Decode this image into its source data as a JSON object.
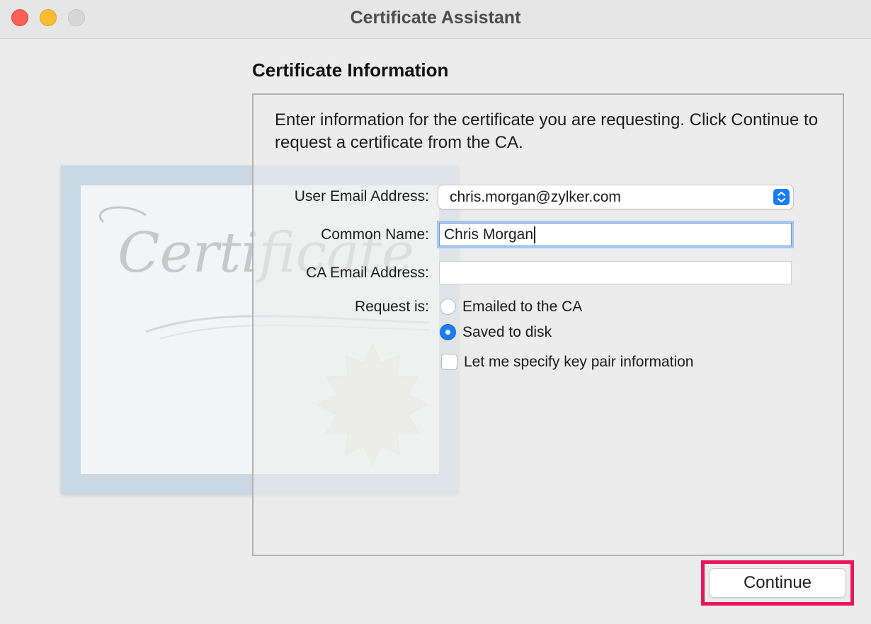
{
  "window": {
    "title": "Certificate Assistant"
  },
  "section": {
    "heading": "Certificate Information",
    "intro": "Enter information for the certificate you are requesting. Click Continue to request a certificate from the CA."
  },
  "form": {
    "user_email_label": "User Email Address:",
    "user_email_value": "chris.morgan@zylker.com",
    "common_name_label": "Common Name:",
    "common_name_value": "Chris Morgan",
    "ca_email_label": "CA Email Address:",
    "ca_email_value": "",
    "request_label": "Request is:",
    "request_options": [
      {
        "label": "Emailed to the CA",
        "selected": false
      },
      {
        "label": "Saved to disk",
        "selected": true
      }
    ],
    "key_pair_label": "Let me specify key pair information",
    "key_pair_checked": false
  },
  "illustration": {
    "script_text": "Certificate"
  },
  "footer": {
    "continue_label": "Continue"
  },
  "colors": {
    "accent": "#1a7cf5",
    "highlight": "#e8175d",
    "close": "#fe5f57",
    "minimize": "#febc2e",
    "zoom_disabled": "#d6d6d6"
  }
}
